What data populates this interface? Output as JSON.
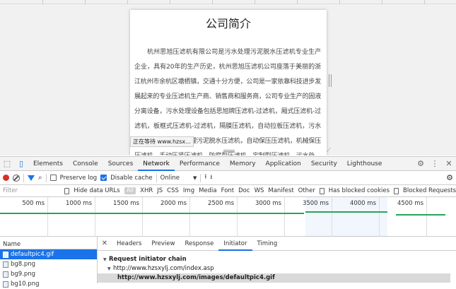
{
  "page": {
    "heading": "公司简介",
    "body": "杭州思旭压滤机有限公司是污水处理污泥脱水压滤机专业生产企业，具有20年的生产历史，杭州思旭压滤机公司座落于美丽的浙江杭州市余杭区塘栖镇，交通十分方便，公司是一家依靠科技进步发展起来的专业压滤机生产商、销售商和服务商，公司专业生产的固液分离设备，污水处理设备包括思旭牌压滤机-过滤机，厢式压滤机-过滤机，板框式压滤机-过滤机，隔膜压滤机，自动拉板压滤机，污水处理压滤机，污水处理污泥脱水压滤机，自动保压压滤机，机械保压压滤机，手动压紧压滤机，防腐型压滤机，定制型压滤机，污水处",
    "status": "正在等待 www.hzsx..."
  },
  "devtools": {
    "tabs": [
      "Elements",
      "Console",
      "Sources",
      "Network",
      "Performance",
      "Memory",
      "Application",
      "Security",
      "Lighthouse"
    ],
    "active_tab": "Network",
    "toolbar": {
      "preserve_log": "Preserve log",
      "disable_cache": "Disable cache",
      "throttle": "Online"
    },
    "filter": {
      "placeholder": "Filter",
      "hide_data_urls": "Hide data URLs",
      "types": [
        "All",
        "XHR",
        "JS",
        "CSS",
        "Img",
        "Media",
        "Font",
        "Doc",
        "WS",
        "Manifest",
        "Other"
      ],
      "has_blocked_cookies": "Has blocked cookies",
      "blocked_requests": "Blocked Requests"
    },
    "timeline": {
      "ticks": [
        "500 ms",
        "1000 ms",
        "1500 ms",
        "2000 ms",
        "2500 ms",
        "3000 ms",
        "3500 ms",
        "4000 ms",
        "4500 ms"
      ]
    },
    "files": {
      "header": "Name",
      "items": [
        "defaultpic4.gif",
        "bg8.png",
        "bg9.png",
        "bg10.png"
      ],
      "selected": "defaultpic4.gif"
    },
    "detail": {
      "tabs": [
        "Headers",
        "Preview",
        "Response",
        "Initiator",
        "Timing"
      ],
      "active": "Initiator",
      "chain_title": "Request initiator chain",
      "chain": [
        "http://www.hzsxylj.com/index.asp",
        "http://www.hzsxylj.com/images/defaultpic4.gif"
      ]
    }
  },
  "colors": {
    "accent": "#1a73e8",
    "record": "#d93025",
    "timeline_bar": "#26a65b"
  }
}
